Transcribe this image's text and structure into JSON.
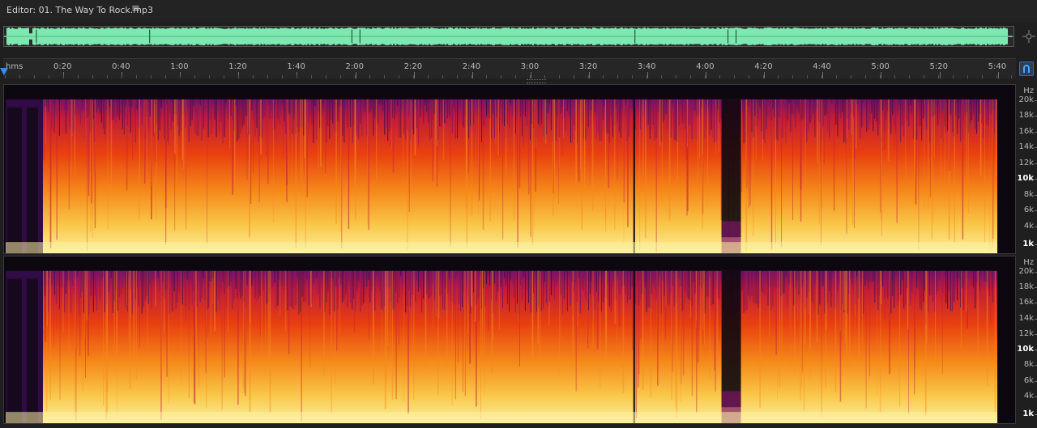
{
  "editor": {
    "title": "Editor: 01. The Way To Rock.mp3",
    "menu_icon": "hamburger-menu-icon"
  },
  "overview": {
    "waveform_color": "#7de8b0",
    "background": "#2a2a2a"
  },
  "ruler": {
    "unit_label": "hms",
    "labels": [
      "0:20",
      "0:40",
      "1:00",
      "1:20",
      "1:40",
      "2:00",
      "2:20",
      "2:40",
      "3:00",
      "3:20",
      "3:40",
      "4:00",
      "4:20",
      "4:40",
      "5:00",
      "5:20",
      "5:40"
    ],
    "playhead_color": "#3a8ee6"
  },
  "frequency_scale": {
    "unit": "Hz",
    "labels": [
      "20k",
      "18k",
      "16k",
      "14k",
      "12k",
      "10k",
      "8k",
      "6k",
      "4k",
      "1k"
    ],
    "bold_labels": [
      "10k",
      "1k"
    ]
  },
  "spectrogram": {
    "channels": 2,
    "palette": [
      "#0d0810",
      "#3a0d52",
      "#7a1466",
      "#c21c38",
      "#e8400f",
      "#f58a1a",
      "#f9c84a",
      "#fbf0a0"
    ],
    "silent_regions_hint": [
      "start",
      "end"
    ]
  },
  "icons": {
    "snap": "magnet-icon",
    "zoom_navigator": "zoom-navigator-icon"
  }
}
